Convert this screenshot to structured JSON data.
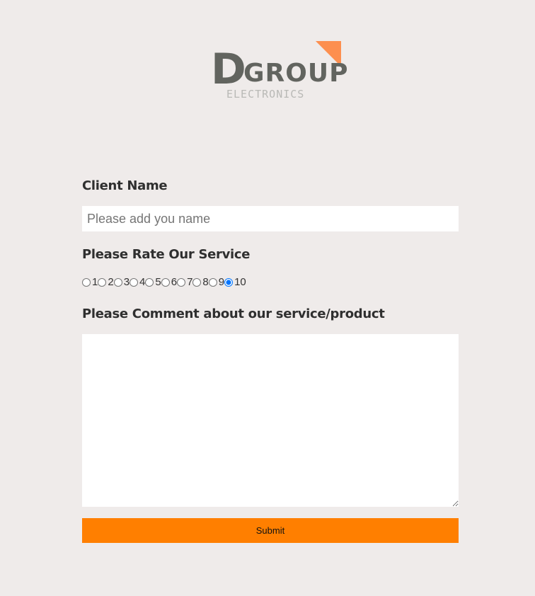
{
  "logo": {
    "letter": "D",
    "word": "GROUP",
    "sub": "ELECTRONICS",
    "accent": "#fd8f4f"
  },
  "form": {
    "name_label": "Client Name",
    "name_placeholder": "Please add you name",
    "name_value": "",
    "rating_label": "Please Rate Our Service",
    "rating_options": [
      "1",
      "2",
      "3",
      "4",
      "5",
      "6",
      "7",
      "8",
      "9",
      "10"
    ],
    "rating_selected": "10",
    "comment_label": "Please Comment about our service/product",
    "comment_value": "",
    "submit_label": "Submit"
  }
}
